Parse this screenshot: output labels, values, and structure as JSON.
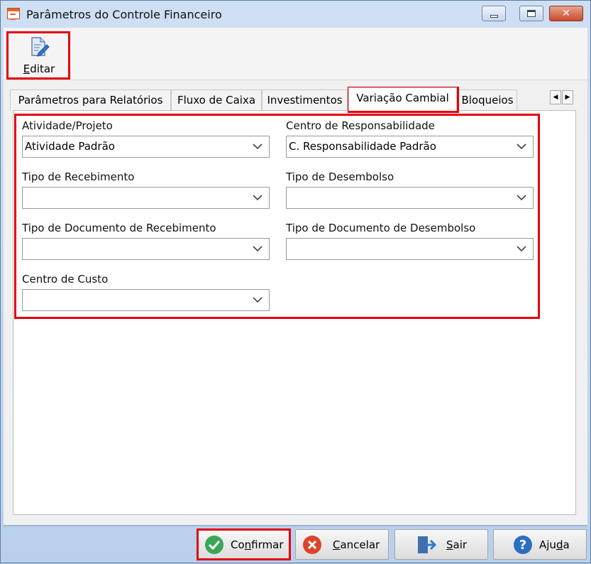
{
  "window": {
    "title": "Parâmetros do Controle Financeiro",
    "controls": {
      "minimize": "minimize",
      "maximize": "maximize",
      "close": "✕"
    }
  },
  "toolbar": {
    "edit": {
      "label": "Editar",
      "mnemonic": "E",
      "rest": "ditar",
      "icon": "edit-document-icon"
    }
  },
  "tabs": [
    {
      "label": "Parâmetros para Relatórios",
      "active": false
    },
    {
      "label": "Fluxo de Caixa",
      "active": false
    },
    {
      "label": "Investimentos",
      "active": false
    },
    {
      "label": "Variação Cambial",
      "active": true
    },
    {
      "label": "Bloqueios",
      "active": false
    }
  ],
  "tab_scroll": {
    "left": "◀",
    "right": "▶"
  },
  "form": {
    "atividade": {
      "label": "Atividade/Projeto",
      "value": "Atividade Padrão"
    },
    "centro_resp": {
      "label": "Centro de Responsabilidade",
      "value": "C. Responsabilidade Padrão"
    },
    "tipo_receb": {
      "label": "Tipo de Recebimento",
      "value": ""
    },
    "tipo_desemb": {
      "label": "Tipo de Desembolso",
      "value": ""
    },
    "tipo_doc_receb": {
      "label": "Tipo de Documento de Recebimento",
      "value": ""
    },
    "tipo_doc_desemb": {
      "label": "Tipo de Documento de Desembolso",
      "value": ""
    },
    "centro_custo": {
      "label": "Centro de Custo",
      "value": ""
    }
  },
  "buttons": {
    "confirmar": {
      "pre": "Co",
      "mnemonic": "n",
      "post": "firmar",
      "icon": "check-circle-icon"
    },
    "cancelar": {
      "pre": "",
      "mnemonic": "C",
      "post": "ancelar",
      "icon": "cancel-circle-icon"
    },
    "sair": {
      "pre": "",
      "mnemonic": "S",
      "post": "air",
      "icon": "exit-door-icon"
    },
    "ajuda": {
      "pre": "Aju",
      "mnemonic": "d",
      "post": "a",
      "icon": "help-circle-icon"
    }
  },
  "colors": {
    "highlight": "#e3000f",
    "accent": "#2b7bd0",
    "ok": "#3aa655",
    "cancel": "#d9462c"
  }
}
